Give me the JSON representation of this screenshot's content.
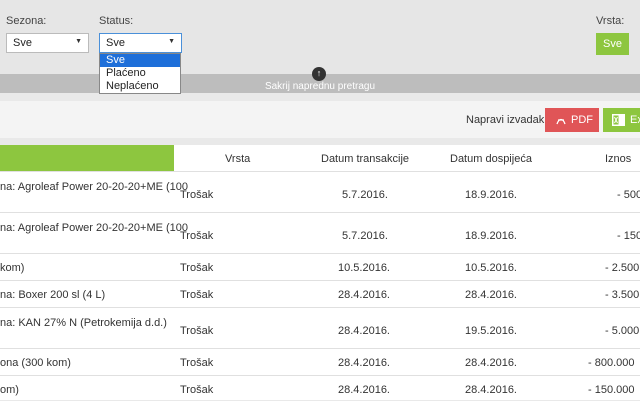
{
  "filters": {
    "season_label": "Sezona:",
    "season_value": "Sve",
    "status_label": "Status:",
    "status_value": "Sve",
    "status_options": [
      "Sve",
      "Plaćeno",
      "Neplaćeno"
    ],
    "type_label": "Vrsta:",
    "type_button": "Sve",
    "hide_search": "Sakrij naprednu pretragu"
  },
  "export": {
    "label": "Napravi izvadak:",
    "pdf": "PDF",
    "excel": "Ex"
  },
  "table": {
    "headers": [
      "Vrsta",
      "Datum transakcije",
      "Datum dospijeća",
      "Iznos"
    ],
    "rows": [
      {
        "desc1": "na: Agroleaf Power 20-20-20+ME (100",
        "desc2": "",
        "type": "Trošak",
        "date": "5.7.2016.",
        "due": "18.9.2016.",
        "amount": "- 500"
      },
      {
        "desc1": "na: Agroleaf Power 20-20-20+ME (100",
        "desc2": "",
        "type": "Trošak",
        "date": "5.7.2016.",
        "due": "18.9.2016.",
        "amount": "- 150"
      },
      {
        "desc1": "kom)",
        "desc2": "",
        "type": "Trošak",
        "date": "10.5.2016.",
        "due": "10.5.2016.",
        "amount": "- 2.500"
      },
      {
        "desc1": "na: Boxer 200 sl (4 L)",
        "desc2": "",
        "type": "Trošak",
        "date": "28.4.2016.",
        "due": "28.4.2016.",
        "amount": "- 3.500"
      },
      {
        "desc1": "na: KAN 27% N (Petrokemija d.d.)",
        "desc2": "",
        "type": "Trošak",
        "date": "28.4.2016.",
        "due": "19.5.2016.",
        "amount": "- 5.000"
      },
      {
        "desc1": "ona (300 kom)",
        "desc2": "",
        "type": "Trošak",
        "date": "28.4.2016.",
        "due": "28.4.2016.",
        "amount": "- 800.000"
      },
      {
        "desc1": "om)",
        "desc2": "",
        "type": "Trošak",
        "date": "28.4.2016.",
        "due": "28.4.2016.",
        "amount": "- 150.000"
      }
    ]
  },
  "colors": {
    "accent_green": "#8dc63f",
    "pdf_red": "#e05557",
    "selected_blue": "#1e6fd9"
  }
}
